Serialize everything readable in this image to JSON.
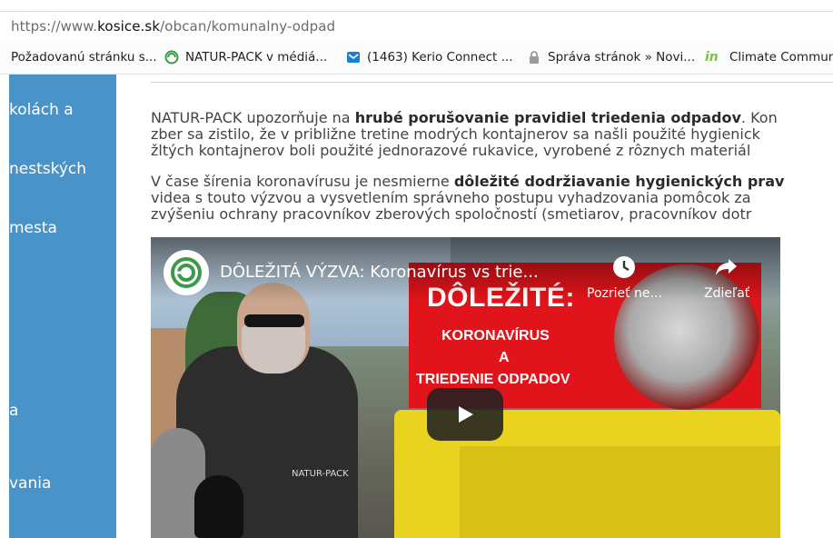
{
  "browser": {
    "url_prefix": "https://www.",
    "url_domain": "kosice.sk",
    "url_path": "/obcan/komunalny-odpad",
    "bookmarks": [
      {
        "label": "Požadovanú stránku s...",
        "icon": "page-icon"
      },
      {
        "label": "NATUR-PACK v médiá...",
        "icon": "naturpack-icon"
      },
      {
        "label": "(1463) Kerio Connect ...",
        "icon": "mail-icon"
      },
      {
        "label": "Správa stránok » Novi...",
        "icon": "lock-icon"
      },
      {
        "label": "Climate Commun",
        "icon": "in-icon"
      }
    ]
  },
  "sidebar": {
    "color": "#4a93c8",
    "items": [
      {
        "label": "kolách a"
      },
      {
        "label": "nestských"
      },
      {
        "label": "mesta"
      },
      {
        "label": "a"
      },
      {
        "label": "vania"
      }
    ]
  },
  "article": {
    "p1": {
      "l1a": "NATUR-PACK upozorňuje na ",
      "l1b": "hrubé porušovanie pravidiel triedenia odpadov",
      "l1c": ". Kon",
      "l2": "zber sa zistilo, že v približne tretine modrých kontajnerov sa našli použité hygienick",
      "l3": "žltých kontajnerov boli použité jednorazové rukavice, vyrobené z rôznych materiál"
    },
    "p2": {
      "l1a": "V čase šírenia koronavírusu je nesmierne ",
      "l1b": "dôležité dodržiavanie hygienických prav",
      "l2": "videa s touto výzvou a vysvetlením správneho postupu vyhadzovania pomôcok za",
      "l3": "zvýšeniu ochrany pracovníkov zberových spoločností (smetiarov, pracovníkov dotr"
    }
  },
  "video": {
    "title": "DÔLEŽITÁ VÝZVA: Koronavírus vs trie...",
    "watch_later_label": "Pozrieť ne...",
    "share_label": "Zdieľať",
    "banner_title": "DÔLEŽITÉ:",
    "banner_line1": "KORONAVÍRUS",
    "banner_line2": "A",
    "banner_line3": "TRIEDENIE ODPADOV",
    "shirt_logo": "NATUR-PACK",
    "banner_color": "#e0141a"
  }
}
